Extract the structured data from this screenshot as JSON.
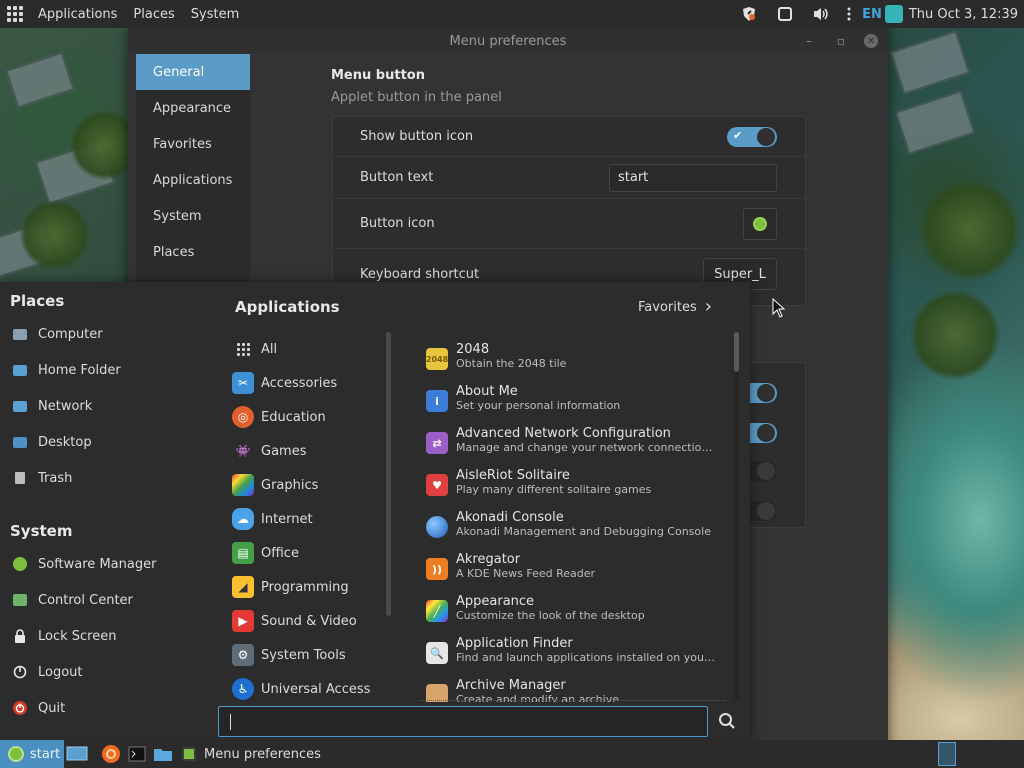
{
  "top_panel": {
    "menus": [
      "Applications",
      "Places",
      "System"
    ],
    "lang": "EN",
    "clock": "Thu Oct  3, 12:39"
  },
  "prefs_window": {
    "title": "Menu preferences",
    "sidebar": [
      "General",
      "Appearance",
      "Favorites",
      "Applications",
      "System",
      "Places"
    ],
    "section_title": "Menu button",
    "section_subtitle": "Applet button in the panel",
    "rows": {
      "show_icon_label": "Show button icon",
      "button_text_label": "Button text",
      "button_text_value": "start",
      "button_icon_label": "Button icon",
      "shortcut_label": "Keyboard shortcut",
      "shortcut_value": "Super_L"
    }
  },
  "start_menu": {
    "places_heading": "Places",
    "places": [
      "Computer",
      "Home Folder",
      "Network",
      "Desktop",
      "Trash"
    ],
    "system_heading": "System",
    "system": [
      "Software Manager",
      "Control Center",
      "Lock Screen",
      "Logout",
      "Quit"
    ],
    "apps_heading": "Applications",
    "favorites_label": "Favorites",
    "categories": [
      "All",
      "Accessories",
      "Education",
      "Games",
      "Graphics",
      "Internet",
      "Office",
      "Programming",
      "Sound & Video",
      "System Tools",
      "Universal Access"
    ],
    "apps": [
      {
        "name": "2048",
        "desc": "Obtain the 2048 tile"
      },
      {
        "name": "About Me",
        "desc": "Set your personal information"
      },
      {
        "name": "Advanced Network Configuration",
        "desc": "Manage and change your network connection sett..."
      },
      {
        "name": "AisleRiot Solitaire",
        "desc": "Play many different solitaire games"
      },
      {
        "name": "Akonadi Console",
        "desc": "Akonadi Management and Debugging Console"
      },
      {
        "name": "Akregator",
        "desc": "A KDE News Feed Reader"
      },
      {
        "name": "Appearance",
        "desc": "Customize the look of the desktop"
      },
      {
        "name": "Application Finder",
        "desc": "Find and launch applications installed on your sys..."
      },
      {
        "name": "Archive Manager",
        "desc": "Create and modify an archive"
      }
    ],
    "search_value": ""
  },
  "bottom_panel": {
    "start_label": "start",
    "task_title": "Menu preferences"
  },
  "colors": {
    "accent": "#5a9bc7",
    "panel": "#2b2b2b",
    "mint": "#7bbf3c"
  }
}
